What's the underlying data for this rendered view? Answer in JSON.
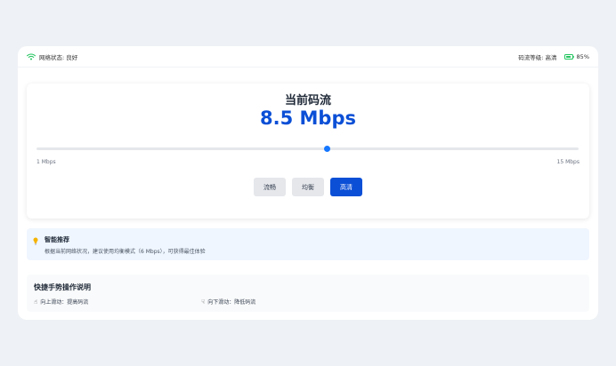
{
  "status_bar": {
    "network_label": "网络状态: 良好",
    "quality_label": "码流等级: 高清",
    "battery": "85%",
    "battery_level": 0.85,
    "icons": {
      "wifi": "wifi-icon",
      "battery": "battery-icon"
    }
  },
  "bitrate_card": {
    "title": "当前码流",
    "value": "8.5 Mbps",
    "slider": {
      "min_label": "1 Mbps",
      "max_label": "15 Mbps",
      "min": 1,
      "max": 15,
      "value": 8.5
    },
    "modes": [
      {
        "label": "流畅",
        "active": false
      },
      {
        "label": "均衡",
        "active": false
      },
      {
        "label": "高清",
        "active": true
      }
    ]
  },
  "recommendation": {
    "title": "智能推荐",
    "text": "根据当前网络状况，建议使用均衡模式（6 Mbps），可获得最佳体验",
    "icon": "lightbulb-icon"
  },
  "gesture_guide": {
    "title": "快捷手势操作说明",
    "items": [
      {
        "icon": "swipe-up-icon",
        "label": "向上滑动：提高码流"
      },
      {
        "icon": "swipe-down-icon",
        "label": "向下滑动：降低码流"
      }
    ]
  },
  "colors": {
    "accent": "#0b4fd6",
    "slider": "#1677ff",
    "battery": "#22c55e",
    "recommend_bg": "#eff6ff"
  }
}
